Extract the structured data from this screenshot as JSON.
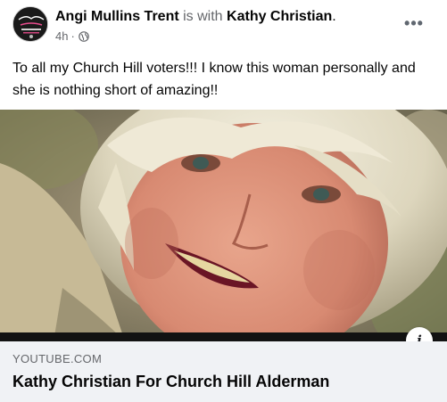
{
  "post": {
    "author": "Angi Mullins Trent",
    "with_text": "is with",
    "tagged": "Kathy Christian",
    "tagged_suffix": ".",
    "time": "4h",
    "separator": "·",
    "audience_icon": "globe-icon",
    "more_icon": "more-options-icon",
    "more_label": "•••",
    "text": "To all my Church Hill voters!!!  I know this woman personally and she is nothing short of amazing!!"
  },
  "link_preview": {
    "image_description_icon": "portrait-photo",
    "info_icon": "info-icon",
    "info_label": "i",
    "domain": "YOUTUBE.COM",
    "title": "Kathy Christian For Church Hill Alderman"
  },
  "colors": {
    "text_primary": "#050505",
    "text_secondary": "#65676b",
    "link_footer_bg": "#f0f2f5"
  }
}
